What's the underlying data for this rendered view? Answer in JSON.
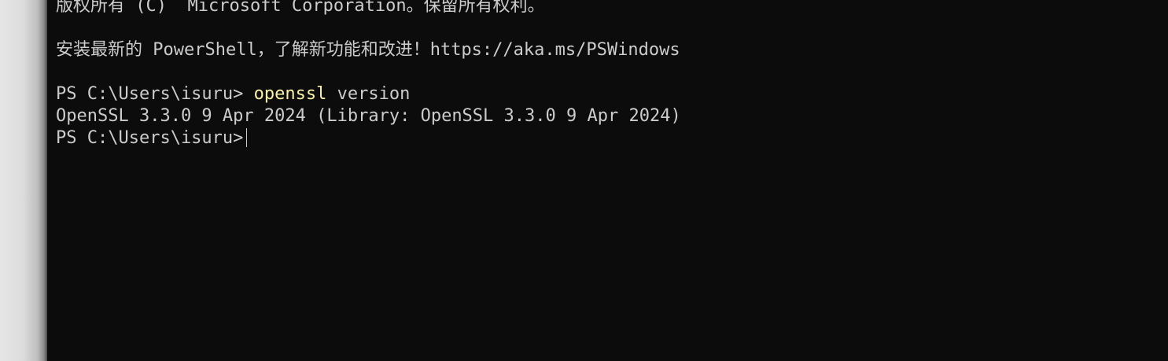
{
  "terminal": {
    "copyright_line": "版权所有 (C)  Microsoft Corporation。保留所有权利。",
    "blank_1": "",
    "install_hint": "安装最新的 PowerShell，了解新功能和改进！https://aka.ms/PSWindows",
    "blank_2": "",
    "prompt": "PS C:\\Users\\isuru> ",
    "command_name": "openssl",
    "command_args": " version",
    "output_line": "OpenSSL 3.3.0 9 Apr 2024 (Library: OpenSSL 3.3.0 9 Apr 2024)",
    "current_prompt": "PS C:\\Users\\isuru>"
  },
  "colors": {
    "background": "#0c0c0c",
    "foreground": "#cccccc",
    "command_highlight": "#f9f1a5"
  }
}
